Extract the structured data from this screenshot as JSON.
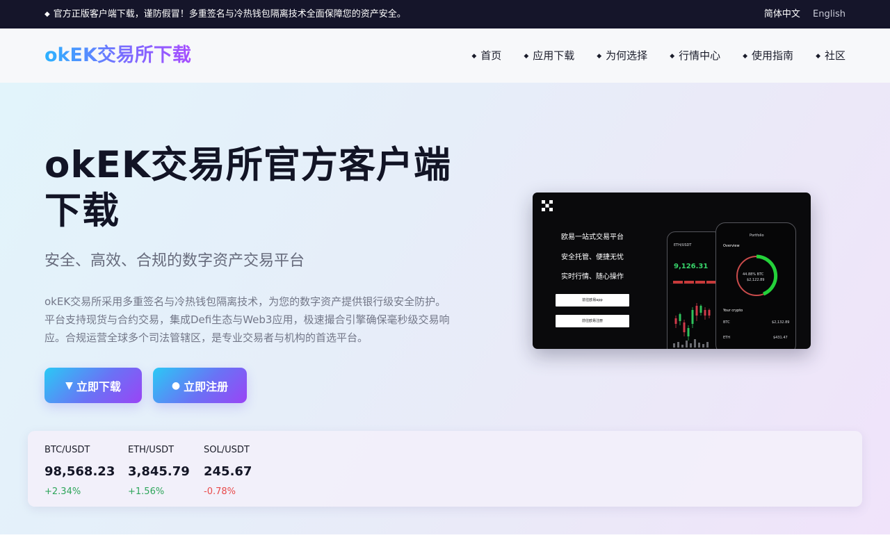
{
  "topbar": {
    "notice": "官方正版客户端下载，谨防假冒！多重签名与冷热钱包隔离技术全面保障您的资产安全。",
    "lang_zh": "简体中文",
    "lang_en": "English"
  },
  "header": {
    "brand": "okEK交易所下载",
    "nav": [
      "首页",
      "应用下载",
      "为何选择",
      "行情中心",
      "使用指南",
      "社区"
    ]
  },
  "hero": {
    "title": "okEK交易所官方客户端下载",
    "subtitle": "安全、高效、合规的数字资产交易平台",
    "description": "okEK交易所采用多重签名与冷热钱包隔离技术，为您的数字资产提供银行级安全防护。平台支持现货与合约交易，集成Defi生态与Web3应用，极速撮合引擎确保毫秒级交易响应。合规运营全球多个司法管辖区，是专业交易者与机构的首选平台。",
    "download_label": "立即下载",
    "register_label": "立即注册"
  },
  "preview": {
    "slogans": [
      "欧易一站式交易平台",
      "安全托管、便捷无忧",
      "实时行情、随心操作"
    ],
    "btn_1": "前往欧易app",
    "btn_2": "前往欧易注册",
    "phone_left": {
      "pair": "ETH/USDT",
      "price": "9,126.31"
    },
    "phone_right": {
      "header": "Portfolio",
      "overview": "Overview",
      "donut_pct": "44.88% BTC",
      "donut_value": "$2,122.89",
      "your_crypto": "Your crypto",
      "assets": [
        {
          "sym": "BTC",
          "value": "$2,132.89"
        },
        {
          "sym": "ETH",
          "value": "$431.47"
        }
      ]
    }
  },
  "ticker": [
    {
      "pair": "BTC/USDT",
      "price": "98,568.23",
      "change": "+2.34%",
      "direction": "up"
    },
    {
      "pair": "ETH/USDT",
      "price": "3,845.79",
      "change": "+1.56%",
      "direction": "up"
    },
    {
      "pair": "SOL/USDT",
      "price": "245.67",
      "change": "-0.78%",
      "direction": "down"
    }
  ],
  "colors": {
    "topbar_bg": "#15152a",
    "brand_gradient_start": "#2bb2ff",
    "brand_gradient_end": "#a64dff",
    "up": "#2ea55a",
    "down": "#e84a4a"
  }
}
